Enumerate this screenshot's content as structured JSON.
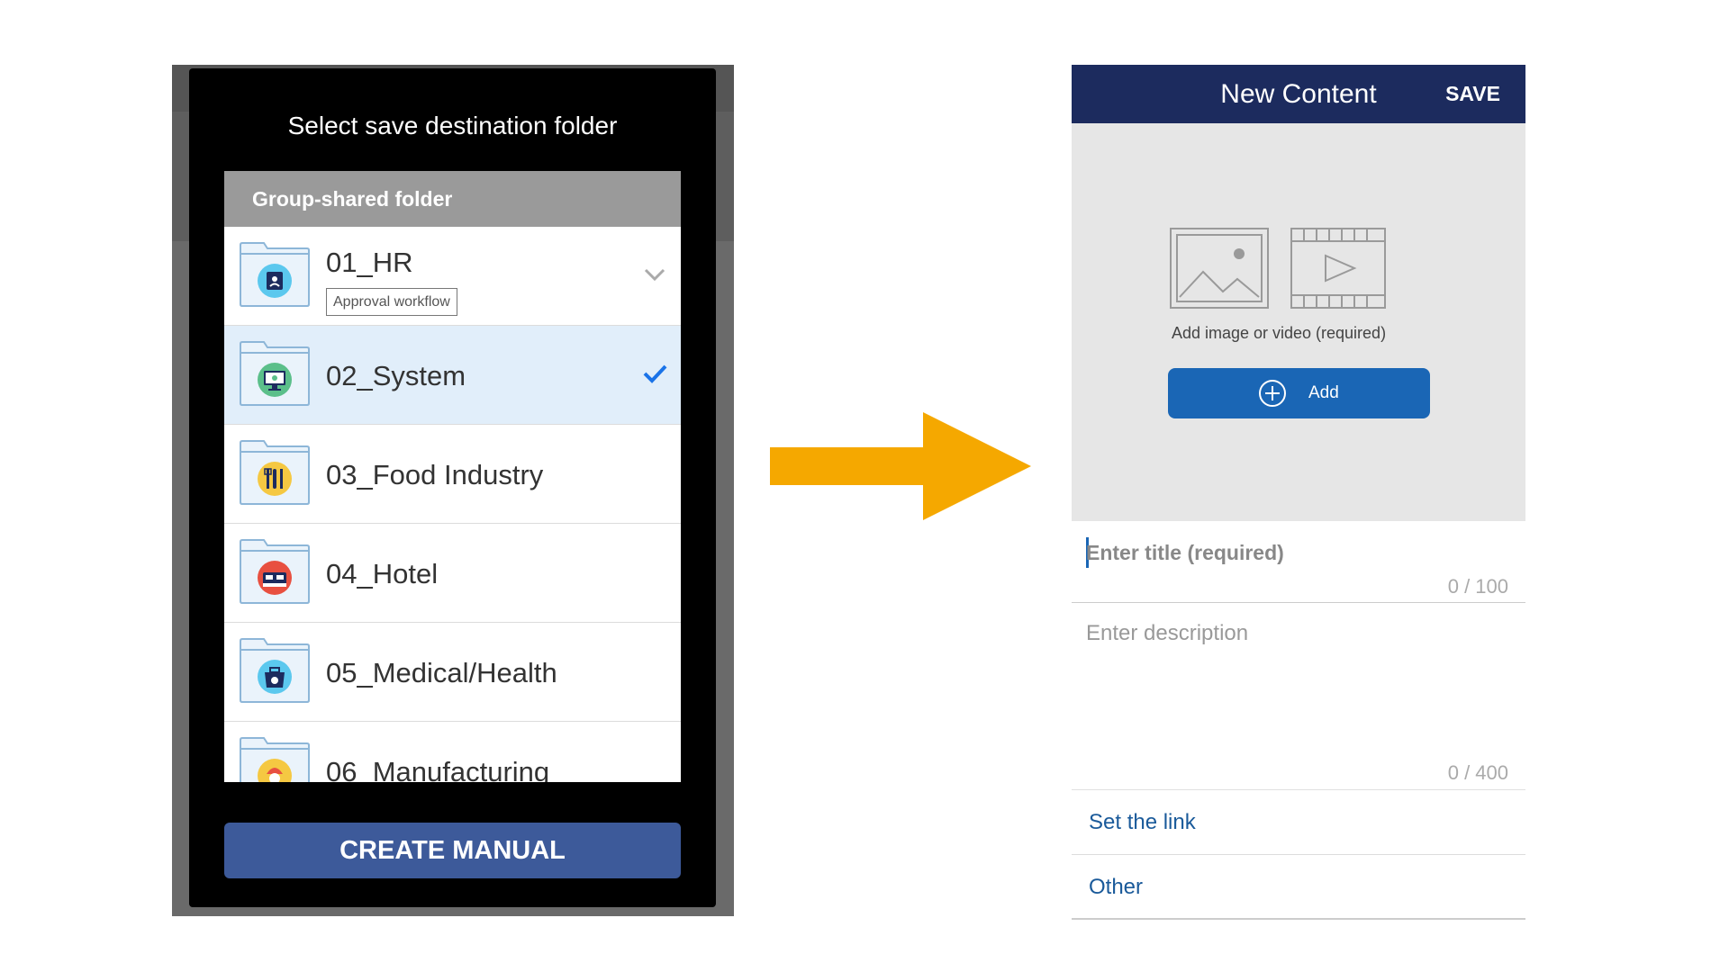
{
  "left_dialog": {
    "title": "Select save destination folder",
    "section_header": "Group-shared folder",
    "folders": [
      {
        "label": "01_HR",
        "badge": "Approval workflow",
        "icon": "hr-badge-icon",
        "color": "#5bc8ee",
        "state": "collapsed"
      },
      {
        "label": "02_System",
        "icon": "computer-monitor-icon",
        "color": "#5bbf8a",
        "state": "selected"
      },
      {
        "label": "03_Food Industry",
        "icon": "cutlery-icon",
        "color": "#f5c842"
      },
      {
        "label": "04_Hotel",
        "icon": "hotel-bed-icon",
        "color": "#e85040"
      },
      {
        "label": "05_Medical/Health",
        "icon": "medical-kit-icon",
        "color": "#5bc8ee"
      },
      {
        "label": "06_Manufacturing",
        "icon": "worker-helmet-icon",
        "color": "#f5c842"
      }
    ],
    "create_button": "CREATE MANUAL"
  },
  "right_screen": {
    "header_title": "New Content",
    "save_label": "SAVE",
    "media_caption": "Add image or video (required)",
    "add_label": "Add",
    "title_placeholder": "Enter title (required)",
    "title_counter": "0 / 100",
    "description_placeholder": "Enter description",
    "description_counter": "0 / 400",
    "set_link_label": "Set the link",
    "other_label": "Other"
  },
  "colors": {
    "header_navy": "#1c2b5e",
    "add_button_blue": "#1a66b5",
    "create_button_blue": "#3d5a9a",
    "arrow_orange": "#f5a800",
    "selected_row": "#e1eefa",
    "check_blue": "#1a73e8"
  }
}
